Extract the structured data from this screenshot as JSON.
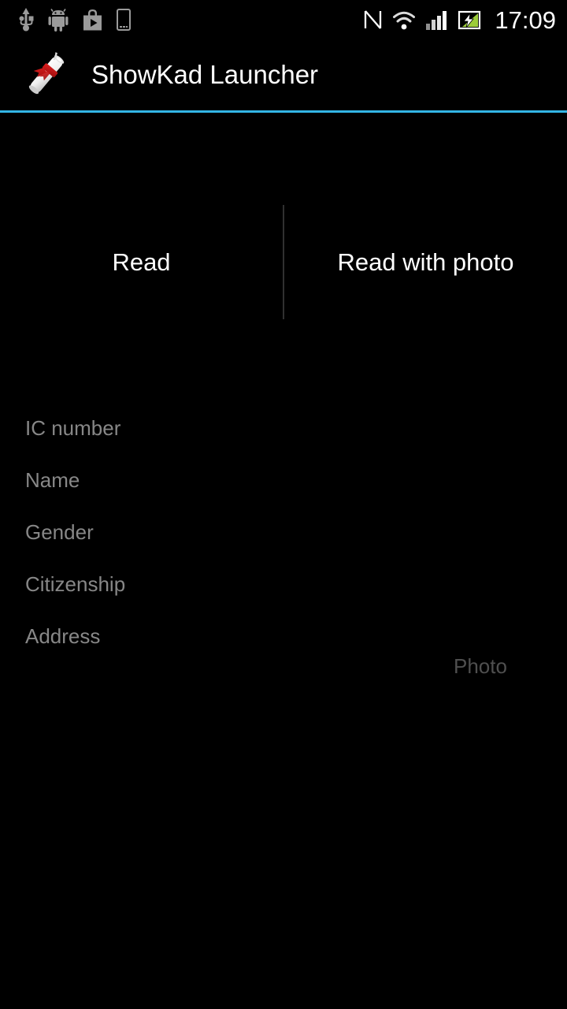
{
  "status_bar": {
    "icons_left": [
      {
        "name": "usb-icon",
        "label": "USB connected"
      },
      {
        "name": "android-debug-icon",
        "label": "USB debugging connected"
      },
      {
        "name": "play-store-icon",
        "label": "Play Store"
      },
      {
        "name": "device-icon",
        "label": "Device"
      }
    ],
    "icons_right": [
      {
        "name": "nfc-icon",
        "label": "NFC"
      },
      {
        "name": "wifi-icon",
        "label": "Wi-Fi"
      },
      {
        "name": "cellular-signal-icon",
        "label": "Cellular signal"
      },
      {
        "name": "battery-charging-icon",
        "label": "Battery charging"
      }
    ],
    "clock": "17:09"
  },
  "action_bar": {
    "icon": "diploma-scroll-icon",
    "title": "ShowKad Launcher",
    "underline_color": "#33b5e5"
  },
  "buttons": {
    "read": "Read",
    "read_with_photo": "Read with photo"
  },
  "fields": {
    "ic_number": "IC number",
    "name": "Name",
    "gender": "Gender",
    "citizenship": "Citizenship",
    "address": "Address",
    "photo": "Photo"
  },
  "colors": {
    "background": "#000000",
    "accent": "#33b5e5",
    "primary_text": "#ffffff",
    "hint_text": "#878787",
    "dim_text": "#4f4f4f",
    "divider": "#303030",
    "status_icon": "#9a9a9a",
    "battery_green": "#8bc34a",
    "ribbon_red": "#c1121c"
  }
}
